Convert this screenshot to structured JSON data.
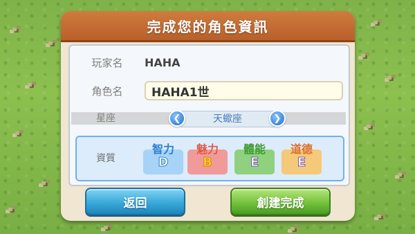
{
  "dialog": {
    "title": "完成您的角色資訊"
  },
  "form": {
    "player_label": "玩家名",
    "player_value": "HAHA",
    "character_label": "角色名",
    "character_value": "HAHA1世",
    "zodiac_label": "星座",
    "zodiac_value": "天蠍座",
    "aptitude_label": "資質"
  },
  "stats": [
    {
      "name": "智力",
      "grade": "D"
    },
    {
      "name": "魅力",
      "grade": "B"
    },
    {
      "name": "體能",
      "grade": "E"
    },
    {
      "name": "道德",
      "grade": "E"
    }
  ],
  "buttons": {
    "back_label": "返回",
    "confirm_label": "創建完成"
  },
  "colors": {
    "header": "#c46a32",
    "back_button": "#35a5d7",
    "confirm_button": "#6fbf3a",
    "aptitude_border": "#6fb1e8"
  }
}
